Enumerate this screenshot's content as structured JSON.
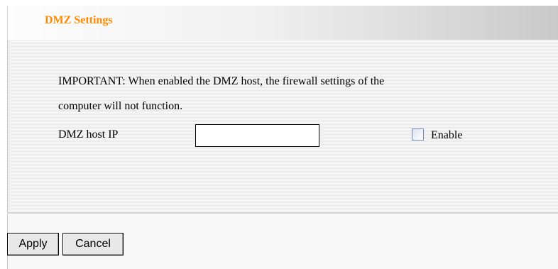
{
  "header": {
    "title": "DMZ Settings"
  },
  "main": {
    "important_line1": "IMPORTANT: When enabled the DMZ host, the firewall settings of the",
    "important_line2": "computer will not function.",
    "dmz_host_ip_label": "DMZ host IP",
    "dmz_host_ip_value": "",
    "enable_label": "Enable",
    "enable_checked": false
  },
  "footer": {
    "apply_label": "Apply",
    "cancel_label": "Cancel"
  },
  "colors": {
    "title": "#ff8a00",
    "checkbox_border": "#6b8bb8"
  }
}
